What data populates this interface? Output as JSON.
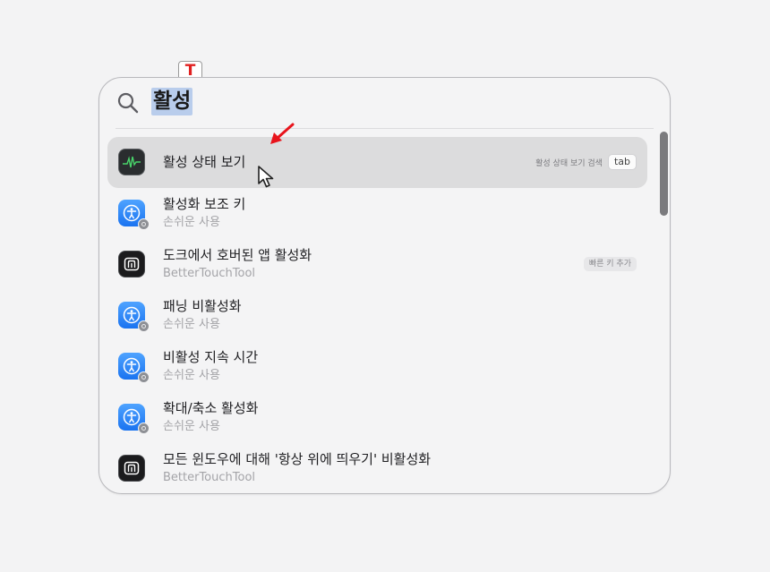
{
  "badge": {
    "letter": "T"
  },
  "search": {
    "query": "활성"
  },
  "results": [
    {
      "title": "활성 상태 보기",
      "subtitle": "",
      "icon": "activity-monitor-icon",
      "hint": "활성 상태 보기 검색",
      "key": "tab"
    },
    {
      "title": "활성화 보조 키",
      "subtitle": "손쉬운 사용",
      "icon": "accessibility-icon"
    },
    {
      "title": "도크에서 호버된 앱 활성화",
      "subtitle": "BetterTouchTool",
      "icon": "bettertouchtool-icon",
      "action": "빠른 키 추가"
    },
    {
      "title": "패닝 비활성화",
      "subtitle": "손쉬운 사용",
      "icon": "accessibility-icon"
    },
    {
      "title": "비활성 지속 시간",
      "subtitle": "손쉬운 사용",
      "icon": "accessibility-icon"
    },
    {
      "title": "확대/축소 활성화",
      "subtitle": "손쉬운 사용",
      "icon": "accessibility-icon"
    },
    {
      "title": "모든 윈도우에 대해 '항상 위에 띄우기' 비활성화",
      "subtitle": "BetterTouchTool",
      "icon": "bettertouchtool-icon"
    }
  ],
  "colors": {
    "selection": "#b9cdec",
    "annotation_arrow": "#e8141c",
    "badge_letter": "#e02020"
  }
}
